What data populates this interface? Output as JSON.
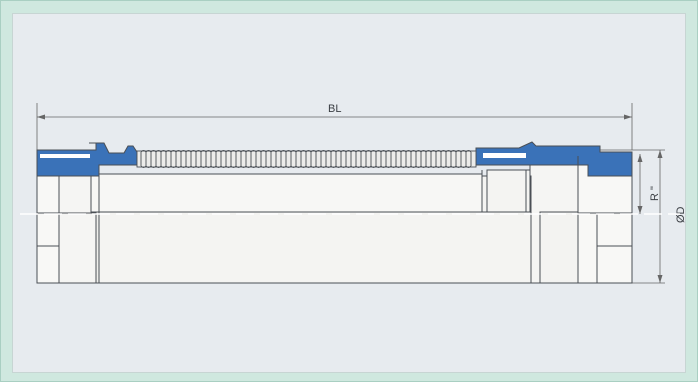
{
  "labels": {
    "bl": "BL",
    "r": "R \"",
    "od": "ØD"
  },
  "colors": {
    "frame": "#cfe8df",
    "panel": "#e7ebef",
    "line": "#4a4f55",
    "blue": "#3a72b8",
    "metal": "#f4f4f2",
    "centerline": "#ffffff"
  }
}
